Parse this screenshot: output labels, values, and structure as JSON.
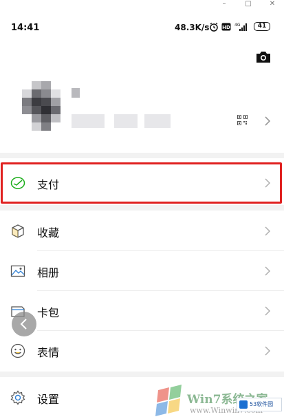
{
  "window": {
    "minimize_glyph": "–",
    "maximize_glyph": "□",
    "close_glyph": "✕"
  },
  "status_bar": {
    "time": "14:41",
    "net_speed": "48.3K/s",
    "signal_label": "4G",
    "battery_level": "41",
    "icons": [
      "alarm-icon",
      "hd-icon",
      "signal-icon",
      "battery-icon"
    ]
  },
  "profile": {
    "camera_icon": "camera-icon",
    "qr_icon": "qr-code-icon",
    "chevron_glyph": "›"
  },
  "menu": {
    "items": [
      {
        "label": "支付",
        "icon": "wallet-pay-icon"
      },
      {
        "label": "收藏",
        "icon": "cube-favorites-icon"
      },
      {
        "label": "相册",
        "icon": "photo-album-icon"
      },
      {
        "label": "卡包",
        "icon": "card-wallet-icon"
      },
      {
        "label": "表情",
        "icon": "smiley-sticker-icon"
      },
      {
        "label": "设置",
        "icon": "gear-icon"
      }
    ],
    "chevron_glyph": "›"
  },
  "watermark": {
    "title": "Win7系统之家",
    "url": "www.Winwin7.com",
    "badge": "53软件园"
  },
  "colors": {
    "highlight": "#e0201f",
    "pay_green": "#1aad19",
    "background": "#ffffff",
    "separator": "#f2f2f2"
  }
}
